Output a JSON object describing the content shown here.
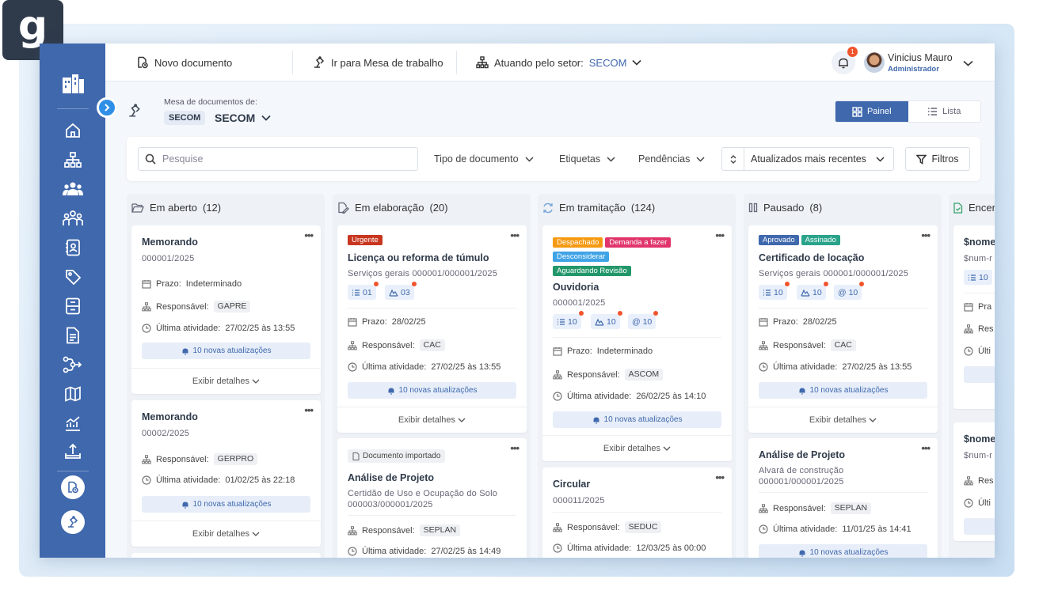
{
  "brand": {
    "letter": "g"
  },
  "topbar": {
    "new_doc": "Novo documento",
    "workdesk": "Ir para Mesa de trabalho",
    "sector_label": "Atuando pelo setor:",
    "sector_value": "SECOM",
    "notifications": "1",
    "user_name": "Vinicius Mauro",
    "user_role": "Administrador"
  },
  "header": {
    "label": "Mesa de documentos de:",
    "chip": "SECOM",
    "title": "SECOM"
  },
  "view": {
    "panel": "Painel",
    "list": "Lista",
    "active": "Painel"
  },
  "filters": {
    "search_placeholder": "Pesquise",
    "doc_type": "Tipo de documento",
    "tags": "Etiquetas",
    "pending": "Pendências",
    "sort": "Atualizados mais recentes",
    "filters_btn": "Filtros"
  },
  "common": {
    "deadline": "Prazo:",
    "responsible": "Responsável:",
    "last_activity": "Última atividade:",
    "details": "Exibir detalhes",
    "updates": "10 novas atualizações"
  },
  "columns": [
    {
      "title": "Em aberto",
      "count": "(12)",
      "cards": [
        {
          "title": "Memorando",
          "number": "000001/2025",
          "deadline": "Indeterminado",
          "responsible": "GAPRE",
          "activity": "27/02/25 às 13:55"
        },
        {
          "title": "Memorando",
          "number": "00002/2025",
          "responsible": "GERPRO",
          "activity": "01/02/25 às 22:18"
        }
      ]
    },
    {
      "title": "Em elaboração",
      "count": "(20)",
      "cards": [
        {
          "tags": [
            "Urgente"
          ],
          "title": "Licença ou reforma de túmulo",
          "subtitle": "Serviços gerais 000001/000001/2025",
          "counters": [
            "01",
            "03"
          ],
          "deadline": "28/02/25",
          "responsible": "CAC",
          "activity": "27/02/25 às 13:55"
        },
        {
          "imported": "Documento importado",
          "title": "Análise de Projeto",
          "subtitle": "Certidão de Uso e Ocupação do Solo",
          "subtitle2": "000003/000001/2025",
          "responsible": "SEPLAN",
          "activity": "27/02/25 às 14:49"
        }
      ]
    },
    {
      "title": "Em tramitação",
      "count": "(124)",
      "cards": [
        {
          "tags": [
            "Despachado",
            "Demanda a fazer",
            "Desconsiderar",
            "Aguardando Revisão"
          ],
          "title": "Ouvidoria",
          "number": "000001/2025",
          "counters": [
            "10",
            "10",
            "@ 10"
          ],
          "deadline": "Indeterminado",
          "responsible": "ASCOM",
          "activity": "26/02/25 às 14:10"
        },
        {
          "title": "Circular",
          "number": "000011/2025",
          "responsible": "SEDUC",
          "activity": "12/03/25 às 00:00"
        }
      ]
    },
    {
      "title": "Pausado",
      "count": "(8)",
      "cards": [
        {
          "tags": [
            "Aprovado",
            "Assinado"
          ],
          "title": "Certificado de locação",
          "subtitle": "Serviços gerais 000001/000001/2025",
          "counters": [
            "10",
            "10",
            "@ 10"
          ],
          "deadline": "28/02/25",
          "responsible": "CAC",
          "activity": "27/02/25 às 13:55"
        },
        {
          "title": "Análise de Projeto",
          "subtitle": "Alvará de construção",
          "subtitle2": "000001/000001/2025",
          "responsible": "SEPLAN",
          "activity": "11/01/25 às 14:41"
        }
      ]
    },
    {
      "title": "Encer",
      "cards": [
        {
          "title": "$nome",
          "number": "$num-r",
          "counter": "10",
          "deadline": "Pra",
          "responsible": "Res",
          "activity": "Últi"
        },
        {
          "title": "$nome",
          "number": "$num-r",
          "responsible": "Res",
          "activity": "Últi"
        }
      ]
    }
  ],
  "colors": {
    "sidebar": "#3f68ad",
    "accent": "#3f68ad",
    "urgent": "#c8361f",
    "dispatched": "#f59a12",
    "todo": "#e0356b",
    "ignore": "#3fa3e6",
    "review": "#22976a",
    "approved": "#3f68ad",
    "signed": "#2aa38a",
    "badge": "#f0542d"
  }
}
